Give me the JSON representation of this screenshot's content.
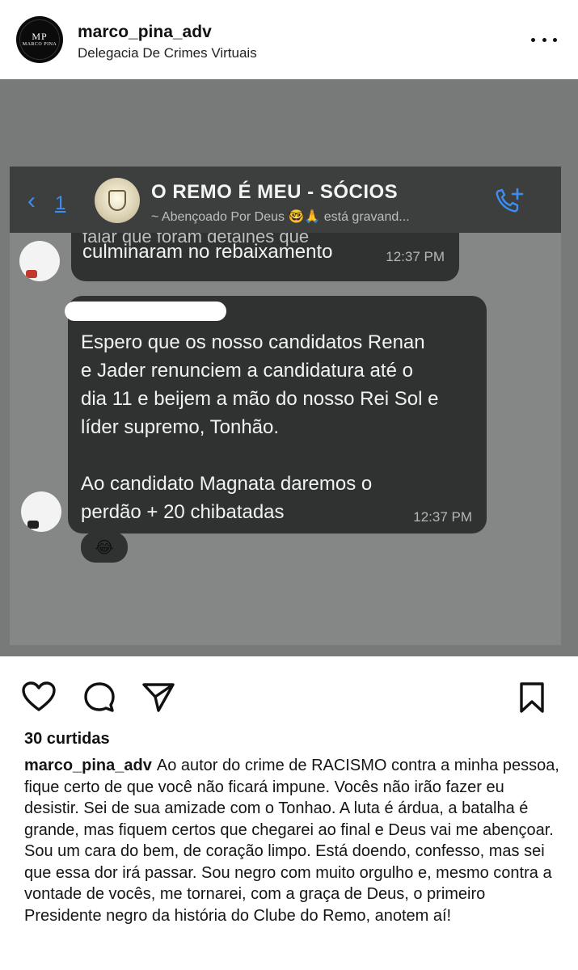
{
  "header": {
    "username": "marco_pina_adv",
    "location": "Delegacia De Crimes Virtuais",
    "avatar_mark": "MP",
    "avatar_label": "MARCO PINA"
  },
  "chat": {
    "back_count": "1",
    "group_title": "O REMO É MEU - SÓCIOS",
    "group_subtitle": "~ Abençoado Por Deus 🤓🙏 está gravand...",
    "message1_partial_top": "falar que foram detalhes que",
    "message1_text": "culminaram no rebaixamento",
    "message1_time": "12:37 PM",
    "message2_text": "Espero que os nosso candidatos Renan\ne Jader renunciem a candidatura até o\ndia 11 e beijem a mão do nosso Rei Sol e\nlíder supremo, Tonhão.\n\nAo candidato Magnata daremos o\nperdão + 20 chibatadas",
    "message2_time": "12:37 PM",
    "reaction": "😂"
  },
  "actions": {
    "icons": [
      "heart-icon",
      "comment-icon",
      "share-icon",
      "bookmark-icon"
    ]
  },
  "likes": "30 curtidas",
  "caption": {
    "username": "marco_pina_adv",
    "text": "Ao autor do crime de RACISMO contra a minha pessoa, fique certo de que você não ficará impune. Vocês não irão fazer eu desistir. Sei de sua amizade com o Tonhao. A luta é árdua, a batalha é grande, mas fiquem certos que chegarei ao final e Deus vai me abençoar. Sou um cara do bem, de coração limpo. Está doendo, confesso, mas sei que essa dor irá passar. Sou negro com muito orgulho e, mesmo contra a vontade de vocês, me tornarei, com a graça de Deus, o primeiro Presidente negro da história do Clube do Remo, anotem aí!"
  },
  "colors": {
    "ios_blue": "#3e8df0",
    "bubble": "#303232",
    "chat_bg": "#848785"
  }
}
